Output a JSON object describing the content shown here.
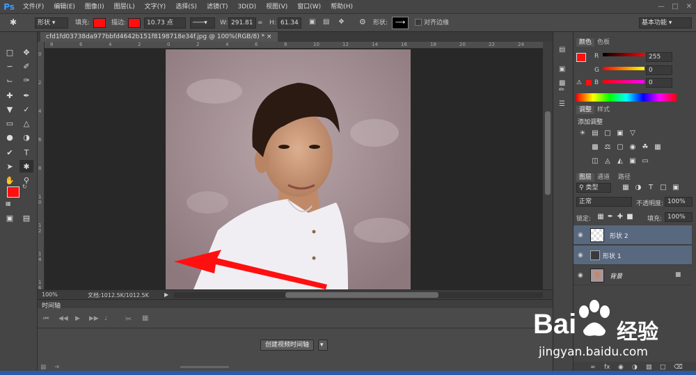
{
  "menubar": {
    "logo": "Ps",
    "items": [
      "文件(F)",
      "编辑(E)",
      "图像(I)",
      "图层(L)",
      "文字(Y)",
      "选择(S)",
      "滤镜(T)",
      "3D(D)",
      "视图(V)",
      "窗口(W)",
      "帮助(H)"
    ]
  },
  "optbar": {
    "shape_mode": "形状",
    "fill_label": "填充:",
    "stroke_label": "描边:",
    "stroke_width": "10.73 点",
    "w_label": "W:",
    "w_value": "291.81",
    "h_label": "H:",
    "h_value": "61.34",
    "shape_label": "形状:",
    "align_edges": "对齐边缘",
    "workspace": "基本功能",
    "fill_color": "#ff1010",
    "stroke_color": "#ff1010"
  },
  "document": {
    "tab_title": "cfd1fd03738da977bbfd4642b151f8198718e34f.jpg @ 100%(RGB/8) *",
    "zoom": "100%",
    "doc_info": "文档:1012.5K/1012.5K",
    "ruler_h_ticks": [
      "8",
      "6",
      "4",
      "2",
      "0",
      "2",
      "4",
      "6",
      "8",
      "10",
      "12",
      "14",
      "16",
      "18",
      "20",
      "22",
      "24"
    ],
    "ruler_v_ticks": [
      "0",
      "2",
      "4",
      "6",
      "8",
      "1 0",
      "1 2",
      "1 4",
      "1 6"
    ]
  },
  "timeline": {
    "title": "时间轴",
    "create_button": "创建视频时间轴"
  },
  "color_panel": {
    "tabs": [
      "颜色",
      "色板"
    ],
    "r_label": "R",
    "g_label": "G",
    "b_label": "B",
    "r_value": "255",
    "g_value": "0",
    "b_value": "0"
  },
  "adjust_panel": {
    "tabs": [
      "调整",
      "样式"
    ],
    "add_label": "添加调整"
  },
  "layers_panel": {
    "tabs": [
      "图层",
      "通道",
      "路径"
    ],
    "filter_kind": "类型",
    "blend_mode": "正常",
    "opacity_label": "不透明度:",
    "opacity_value": "100%",
    "lock_label": "锁定:",
    "fill_label": "填充:",
    "fill_value": "100%",
    "layers": [
      {
        "name": "形状 2",
        "selected": true
      },
      {
        "name": "形状 1",
        "selected": true
      },
      {
        "name": "背景",
        "selected": false
      }
    ]
  },
  "watermark": {
    "brand": "Bai",
    "brand2": "经验",
    "url": "jingyan.baidu.com"
  },
  "colors": {
    "accent_red": "#ff1010",
    "panel_bg": "#454545",
    "selected_layer": "#58687e"
  }
}
